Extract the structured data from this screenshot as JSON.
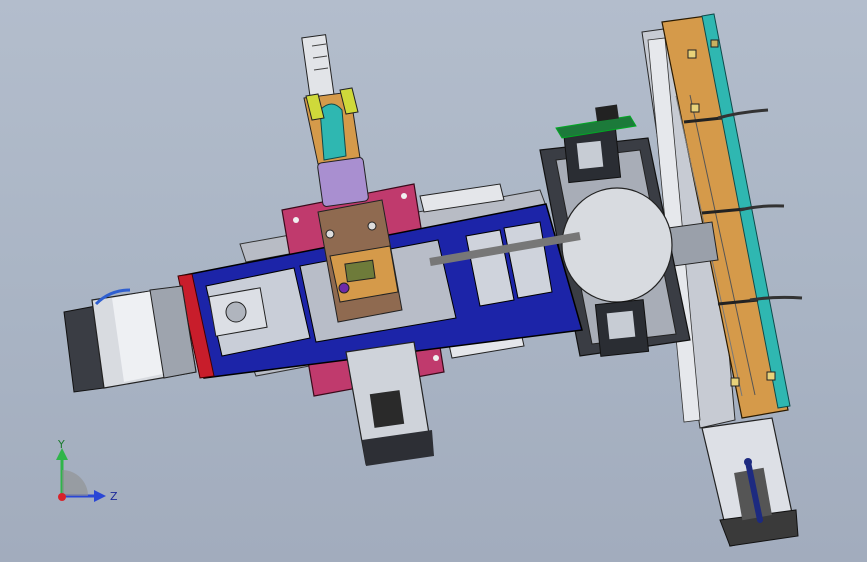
{
  "app": {
    "view": "cad-3d-viewport"
  },
  "palette": {
    "background_top": "#b3bdcc",
    "background_bottom": "#a2acbd",
    "frame_blue": "#1c24a8",
    "plate_pink": "#c03a6d",
    "plate_orange": "#d59a4a",
    "rail_cyan": "#2fb7b1",
    "motor_silver": "#d8dbe0",
    "lavender": "#a98fd0",
    "red_cap": "#c81d2b",
    "triad_y": "#2fb54a",
    "triad_z": "#2946d6",
    "triad_x": "#d8232a"
  },
  "triad": {
    "y_label": "Y",
    "z_label": "Z",
    "icons": [
      "axis-y-arrow",
      "axis-z-arrow",
      "axis-origin"
    ]
  }
}
